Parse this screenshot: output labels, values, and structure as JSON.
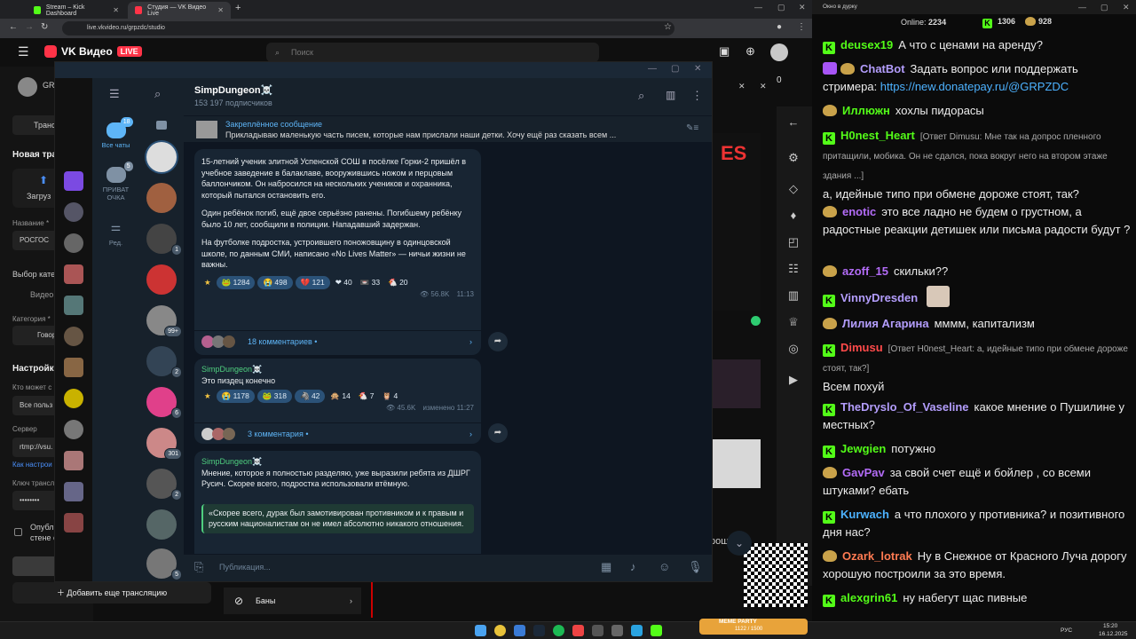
{
  "browser": {
    "tabs": [
      {
        "label": "Stream – Kick Dashboard",
        "active": false
      },
      {
        "label": "Студия — VK Видео Live",
        "active": true
      }
    ],
    "url": "live.vkvideo.ru/grpzdc/studio",
    "new_tab": "+",
    "vk": {
      "logo": "VK Видео",
      "live_badge": "LIVE",
      "search_placeholder": "Поиск"
    }
  },
  "studio": {
    "user_short": "GR",
    "tab_trans": "Транс",
    "new_trans": "Новая тра",
    "upload": "Загруз",
    "name_label": "Название *",
    "name_value": "РОСГОС",
    "category_choice": "Выбор кате",
    "video_label": "Видео",
    "category_label": "Категория *",
    "category_value": "Говор",
    "settings": "Настройки",
    "who_can": "Кто может с",
    "all_users": "Все польз",
    "server_label": "Сервер",
    "server_value": "rtmp://vsu.",
    "how_setup": "Как настрои",
    "key_label": "Ключ трансл",
    "publish_label": "Опубликовать",
    "wall_label": "стене сообщест",
    "add_stream": "Добавить еще трансляцию",
    "bans": "Баны",
    "right_counter": "0",
    "pour": "рошую"
  },
  "telegram": {
    "folders": [
      {
        "label": "Все чаты",
        "badge": "18",
        "active": true
      },
      {
        "label": "ПРИВАТ ОЧКА",
        "badge": "5",
        "active": false
      },
      {
        "label": "Ред.",
        "badge": "",
        "active": false
      }
    ],
    "chat_badges": [
      "",
      "",
      "1",
      "",
      "99+",
      "2",
      "6",
      "301",
      "2",
      "",
      "5"
    ],
    "channel": {
      "name": "SimpDungeon☠️",
      "subscribers": "153 197 подписчиков"
    },
    "pinned": {
      "title": "Закреплённое сообщение",
      "text": "Прикладываю маленькую часть писем, которые нам прислали наши детки.   Хочу ещё раз сказать всем ..."
    },
    "messages": [
      {
        "paragraphs": [
          "15-летний ученик элитной Успенской СОШ в посёлке Горки-2 пришёл в учебное заведение в балаклаве, вооружившись ножом и перцовым баллончиком. Он набросился на нескольких учеников и охранника, который пытался остановить его.",
          "Один ребёнок погиб, ещё двое серьёзно ранены. Погибшему ребёнку было 10 лет, сообщили в полиции. Нападавший задержан.",
          "На футболке подростка, устроившего поножовщину в одинцовской школе, по данным СМИ, написано «No Lives Matter» — ничьи жизни не важны."
        ],
        "reactions": [
          "★",
          "🐸 1284",
          "😭 498",
          "💔 121",
          "❤ 40",
          "📼 33",
          "🐔 20"
        ],
        "views": "56.8K",
        "time": "11:13",
        "comments": "18 комментариев"
      },
      {
        "sender": "SimpDungeon☠️",
        "text": "Это пиздец конечно",
        "reactions": [
          "★",
          "😭 1178",
          "🐸 318",
          "🦓 42",
          "🙊 14",
          "🐔 7",
          "🦉 4"
        ],
        "views": "45.6K",
        "time": "изменено 11:27",
        "comments": "3 комментария"
      },
      {
        "sender": "SimpDungeon☠️",
        "text": "Мнение, которое я полностью разделяю, уже выразили ребята из ДШРГ Русич. Скорее всего, подростка использовали втёмную.",
        "quote": "«Скорее всего, дурак был замотивирован противником и к правым и русским националистам он не имел абсолютно никакого отношения."
      }
    ],
    "input_placeholder": "Публикация..."
  },
  "chat": {
    "window_title": "Окно в дурку",
    "online_label": "Online:",
    "online": "2234",
    "kick_count": "1306",
    "vk_count": "928",
    "lines": [
      {
        "badge": "k",
        "name": "deusex19",
        "color": "#53fc18",
        "text": "А что с ценами на аренду?"
      },
      {
        "badge": "bot",
        "name": "ChatBot",
        "color": "#b39dfc",
        "text": "Задать вопрос или поддержать стримера: ",
        "link": "https://new.donatepay.ru/@GRPZDC"
      },
      {
        "badge": "vk",
        "name": "Иллюжн",
        "color": "#53fc18",
        "text": "хохлы пидорасы"
      },
      {
        "badge": "k",
        "name": "H0nest_Heart",
        "color": "#53fc18",
        "reply": "[Ответ Dimusu: Мне так на допрос пленного притащили, мобика. Он не сдался, пока вокруг него на втором этаже здания ...]",
        "text": "а, идейные типо при обмене дороже стоят, так?"
      },
      {
        "badge": "vk",
        "name": "enotic",
        "color": "#b36cf7",
        "text": "это все ладно не будем о грустном, а радостные реакции детишек или письма радости будут ?"
      },
      {
        "badge": "vk",
        "name": "azoff_15",
        "color": "#b36cf7",
        "text": "скильки??"
      },
      {
        "badge": "k",
        "name": "VinnyDresden",
        "color": "#b39dfc",
        "text": ""
      },
      {
        "badge": "vk",
        "name": "Лилия Агарина",
        "color": "#b39dfc",
        "text": "мммм, капитализм"
      },
      {
        "badge": "k",
        "name": "Dimusu",
        "color": "#ff4a4a",
        "reply": "[Ответ H0nest_Heart: а, идейные типо при обмене дороже стоят, так?]",
        "text": "Всем похуй"
      },
      {
        "badge": "k",
        "name": "TheDryslo_Of_Vaseline",
        "color": "#b39dfc",
        "text": "какое мнение о Пушилине у местных?"
      },
      {
        "badge": "k",
        "name": "Jewgien",
        "color": "#53fc18",
        "text": "потужно"
      },
      {
        "badge": "vk",
        "name": "GavPav",
        "color": "#b36cf7",
        "text": "за свой счет ещё и бойлер , со всеми штуками? ебать"
      },
      {
        "badge": "k",
        "name": "Kurwach",
        "color": "#4db2ff",
        "text": "а что плохого у противника? и позитивного дня нас?"
      },
      {
        "badge": "vk",
        "name": "Ozark_lotrak",
        "color": "#ff7b52",
        "text": "Ну в Снежное от Красного Луча дорогу хорошую построили за это время."
      },
      {
        "badge": "k",
        "name": "alexgrin61",
        "color": "#53fc18",
        "text": "ну набегут щас пивные"
      }
    ]
  },
  "taskbar": {
    "lang": "РУС",
    "time": "15:20",
    "date": "16.12.2025",
    "meme_party": "MEME PARTY",
    "meme_count": "1122 / 1500"
  }
}
